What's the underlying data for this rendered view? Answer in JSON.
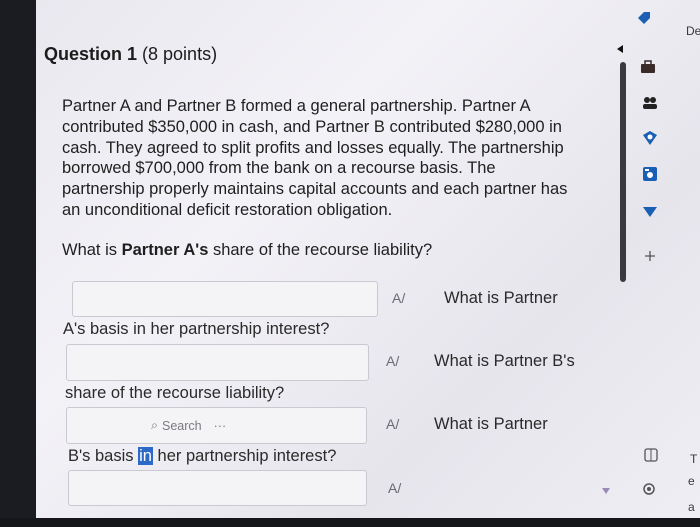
{
  "question": {
    "title": "Question 1",
    "points": "(8 points)",
    "body": "Partner A and Partner B formed a general partnership. Partner A contributed $350,000 in cash, and Partner B contributed $280,000 in cash. They agreed to split profits and losses equally. The partnership borrowed $700,000 from the bank on a recourse basis. The partnership properly maintains capital accounts and each partner has an unconditional deficit restoration obligation.",
    "prompt_pre": "What is ",
    "prompt_bold": "Partner A's",
    "prompt_post": " share of the recourse liability?"
  },
  "fields": [
    {
      "value": "",
      "after_label_right": "What is Partner",
      "after_label_left": "A's basis in her partnership interest?"
    },
    {
      "value": "",
      "after_label_right": "What is Partner B's",
      "after_label_left": "share of the recourse liability?"
    },
    {
      "value": "",
      "after_label_right": "What is Partner",
      "after_label_left_pre": "B's basis ",
      "after_label_left_hl": "in",
      "after_label_left_post": " her partnership interest?"
    },
    {
      "value": ""
    }
  ],
  "search_pill": {
    "label": "Search",
    "more": "···"
  },
  "spell_icon": "A/",
  "sidebar": {
    "icons": [
      "tag-icon",
      "chevron-left-icon",
      "briefcase-icon",
      "people-icon",
      "shield-icon",
      "image-icon",
      "filter-icon",
      "plus-icon",
      "stop-icon",
      "gear-icon",
      "arrow-down-icon"
    ]
  },
  "edge": {
    "top_right": "De",
    "right1": "T",
    "right2": "e",
    "right3": "a"
  },
  "colors": {
    "accent": "#2d6ac7",
    "icon_blue": "#1a5fb4"
  }
}
